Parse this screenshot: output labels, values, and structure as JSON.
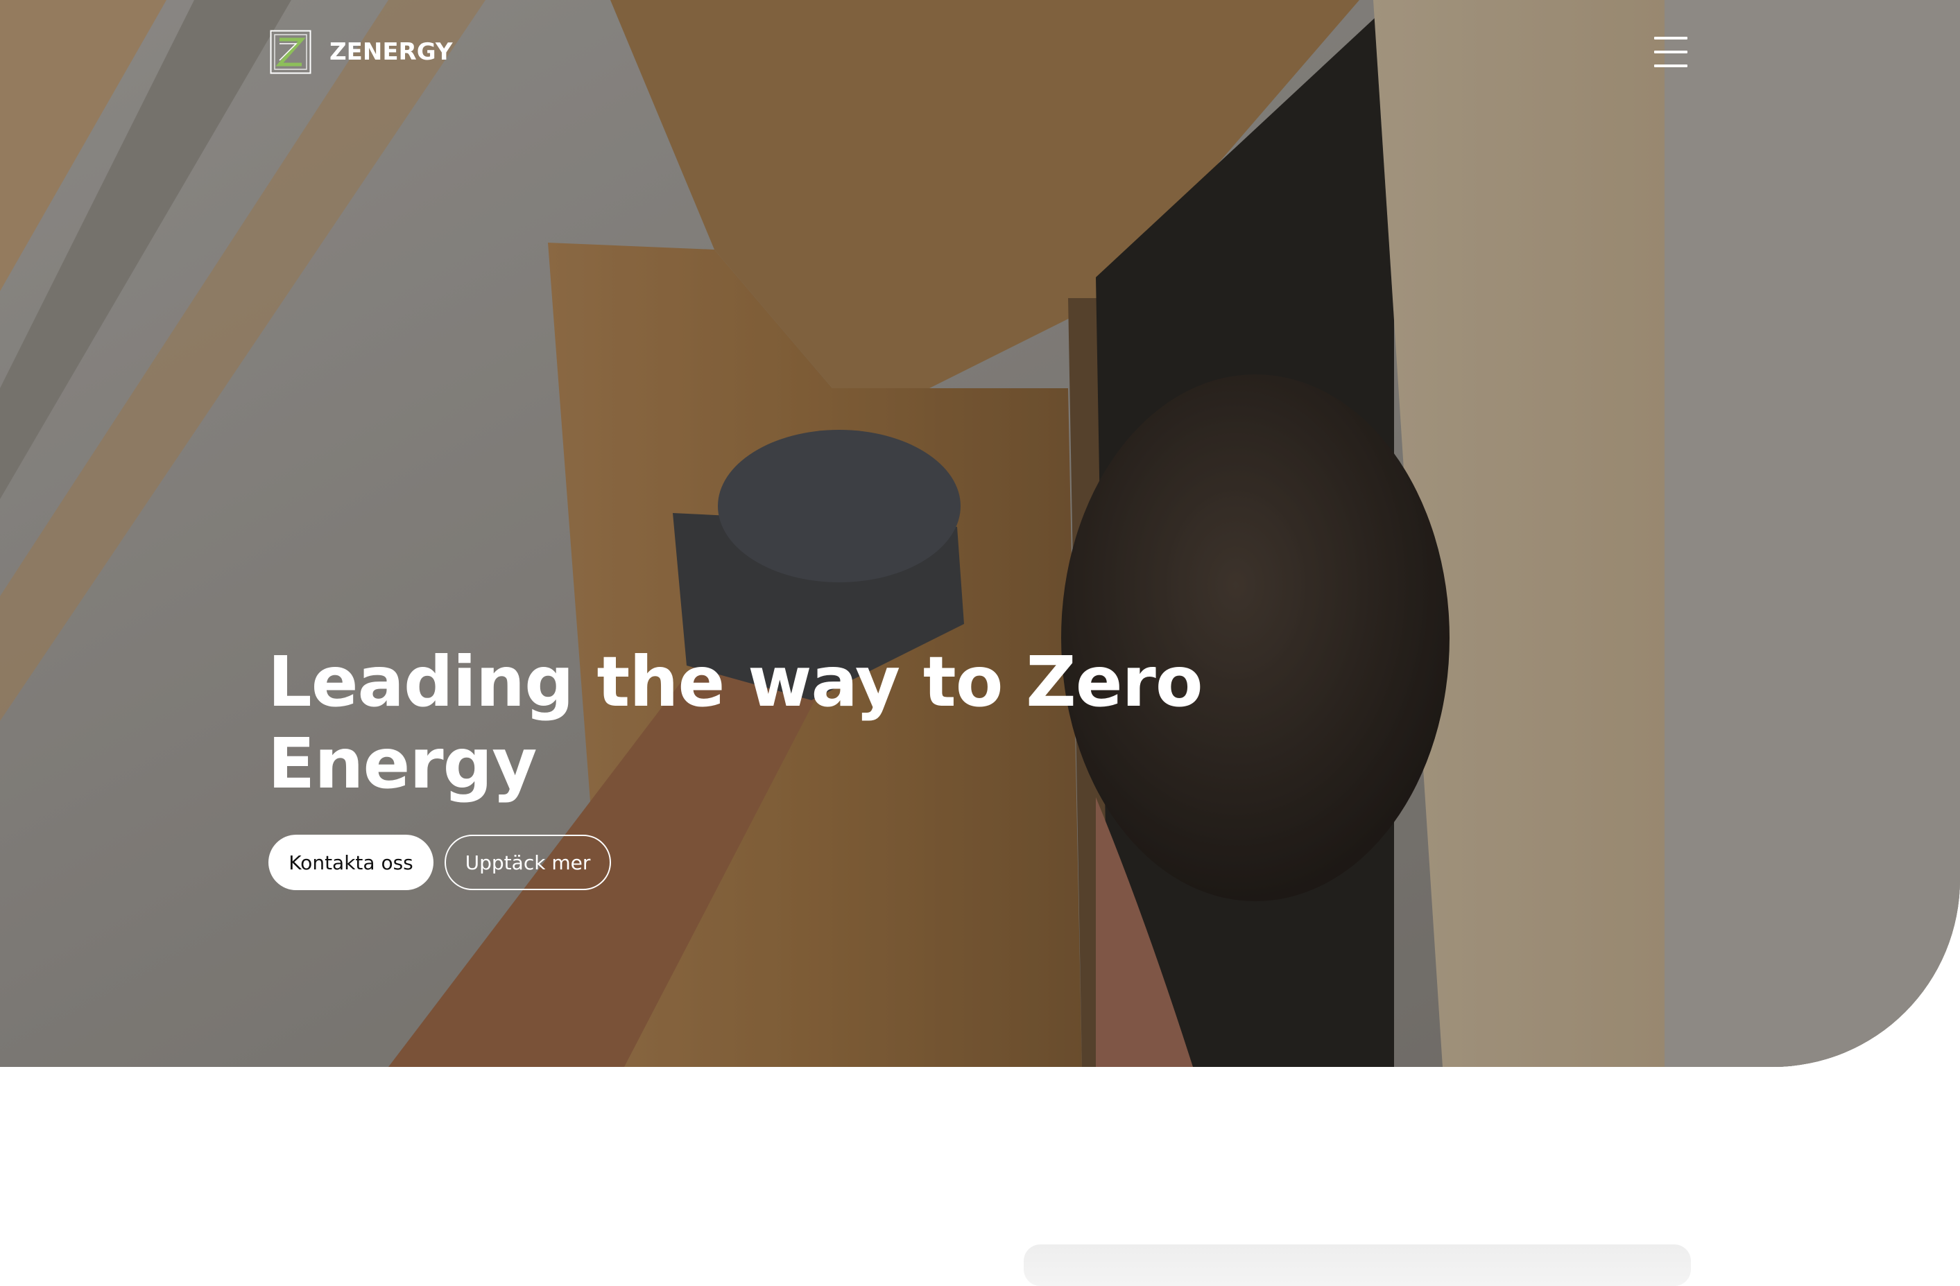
{
  "header": {
    "brand_name": "ZENERGY",
    "logo_icon": "zenergy-z-logo-icon",
    "menu_icon": "hamburger-menu-icon"
  },
  "hero": {
    "headline": "Leading the way to Zero Energy",
    "primary_button_label": "Kontakta oss",
    "secondary_button_label": "Upptäck mer"
  },
  "colors": {
    "text_on_hero": "#ffffff",
    "primary_button_bg": "#ffffff",
    "primary_button_text": "#111111",
    "logo_accent": "#8dbf5a"
  }
}
